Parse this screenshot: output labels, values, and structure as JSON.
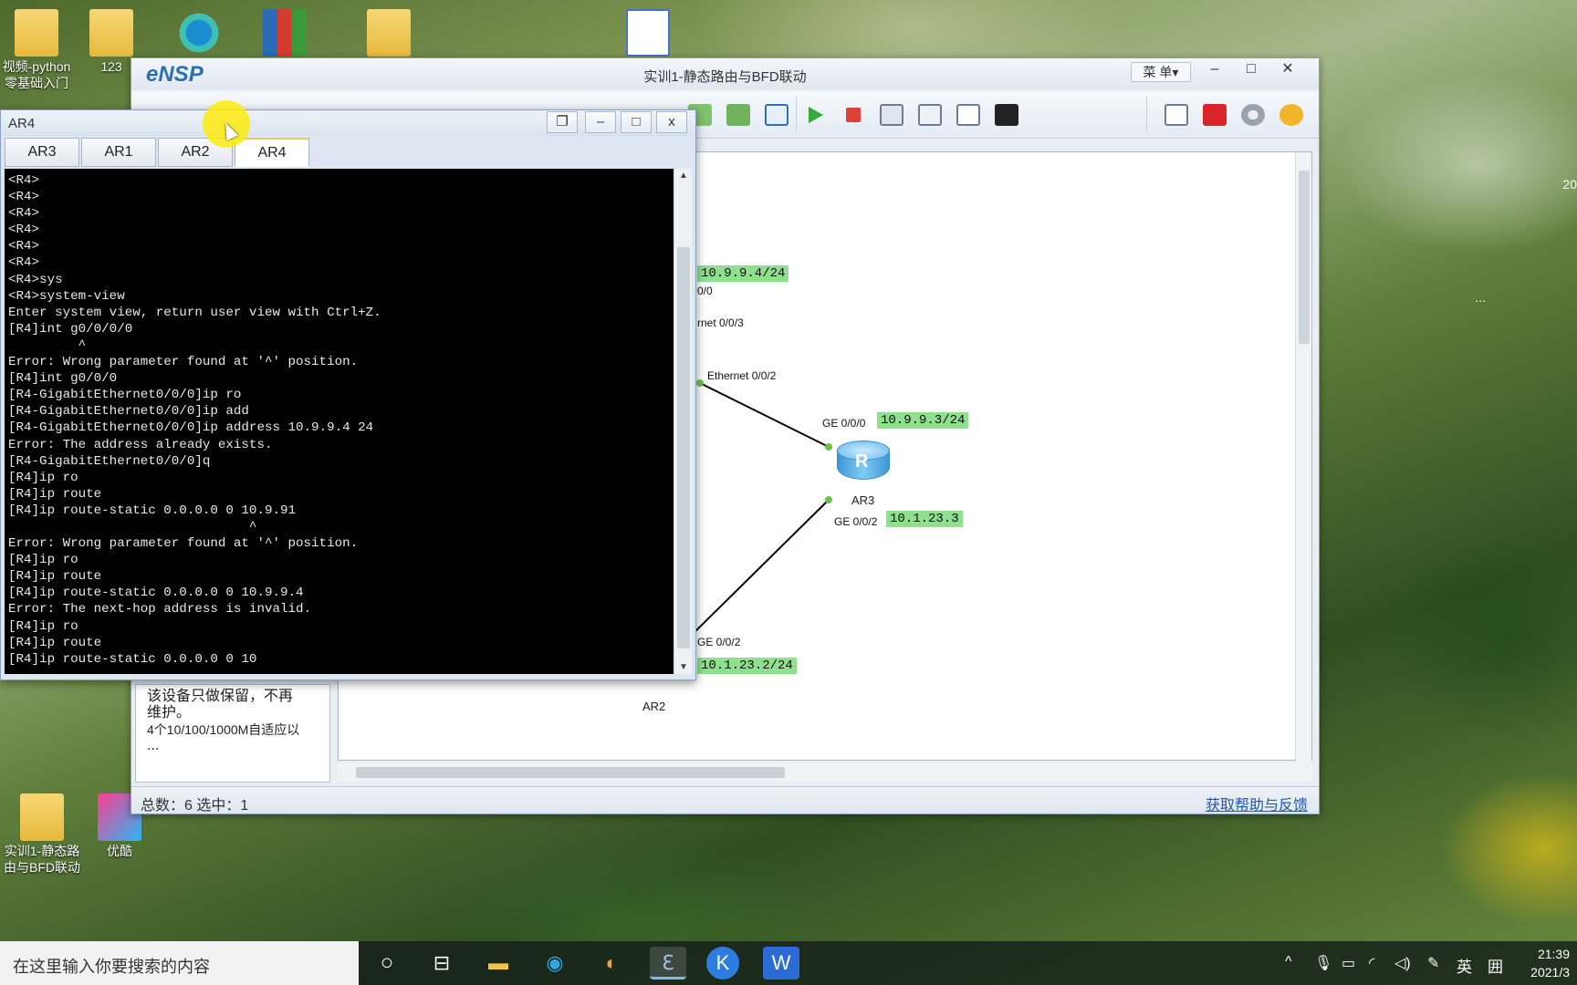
{
  "desktop": {
    "icons": [
      {
        "label_line1": "视频-python",
        "label_line2": "零基础入门"
      },
      {
        "label_line1": "123"
      },
      {
        "label_line1": ""
      },
      {
        "label_line1": ""
      },
      {
        "label_line1": ""
      },
      {
        "label_line1": ""
      },
      {
        "label_line1": "实训1-静态路",
        "label_line2": "由与BFD联动"
      },
      {
        "label_line1": "优酷"
      }
    ],
    "edge_text_1": "20",
    "edge_text_2": "..."
  },
  "ensp": {
    "logo": "eNSP",
    "title": "实训1-静态路由与BFD联动",
    "menu_label": "菜 单▾",
    "minimize": "–",
    "maximize": "□",
    "close": "✕",
    "left_panel": {
      "line1": "该设备只做保留，不再",
      "line2": "维护。",
      "line3": "4个10/100/1000M自适应以",
      "line4": "..."
    },
    "status_bar": {
      "left": "总数：6  选中：1",
      "help_link": "获取帮助与反馈"
    },
    "topology": {
      "ip_ar4": "10.9.9.4/24",
      "if_ar4": "0/0",
      "if_sw_eth3": "rnet 0/0/3",
      "if_sw_eth2": "Ethernet 0/0/2",
      "ar3_ge000": "GE 0/0/0",
      "ip_ar3_ge000": "10.9.9.3/24",
      "ar3_name": "AR3",
      "ar3_ge002": "GE 0/0/2",
      "ip_ar3_ge002": "10.1.23.3",
      "ar2_ge002": "GE 0/0/2",
      "ip_ar2": "10.1.23.2/24",
      "ar2_name": "AR2"
    }
  },
  "ar4_window": {
    "title": "AR4",
    "tabs": [
      {
        "label": "AR3",
        "active": false
      },
      {
        "label": "AR1",
        "active": false
      },
      {
        "label": "AR2",
        "active": false
      },
      {
        "label": "AR4",
        "active": true
      }
    ],
    "terminal_lines": [
      "<R4>",
      "<R4>",
      "<R4>",
      "<R4>",
      "<R4>",
      "<R4>",
      "<R4>sys",
      "<R4>system-view",
      "Enter system view, return user view with Ctrl+Z.",
      "[R4]int g0/0/0/0",
      "         ^",
      "Error: Wrong parameter found at '^' position.",
      "[R4]int g0/0/0",
      "[R4-GigabitEthernet0/0/0]ip ro",
      "[R4-GigabitEthernet0/0/0]ip add",
      "[R4-GigabitEthernet0/0/0]ip address 10.9.9.4 24",
      "Error: The address already exists.",
      "[R4-GigabitEthernet0/0/0]q",
      "[R4]ip ro",
      "[R4]ip route",
      "[R4]ip route-static 0.0.0.0 0 10.9.91",
      "                               ^",
      "Error: Wrong parameter found at '^' position.",
      "[R4]ip ro",
      "[R4]ip route",
      "[R4]ip route-static 0.0.0.0 0 10.9.9.4",
      "Error: The next-hop address is invalid.",
      "[R4]ip ro",
      "[R4]ip route",
      "[R4]ip route-static 0.0.0.0 0 10"
    ]
  },
  "taskbar": {
    "search_placeholder": "在这里输入你要搜索的内容",
    "tray_ime": "英",
    "tray_grid": "囲",
    "time": "21:39",
    "date": "2021/3"
  }
}
